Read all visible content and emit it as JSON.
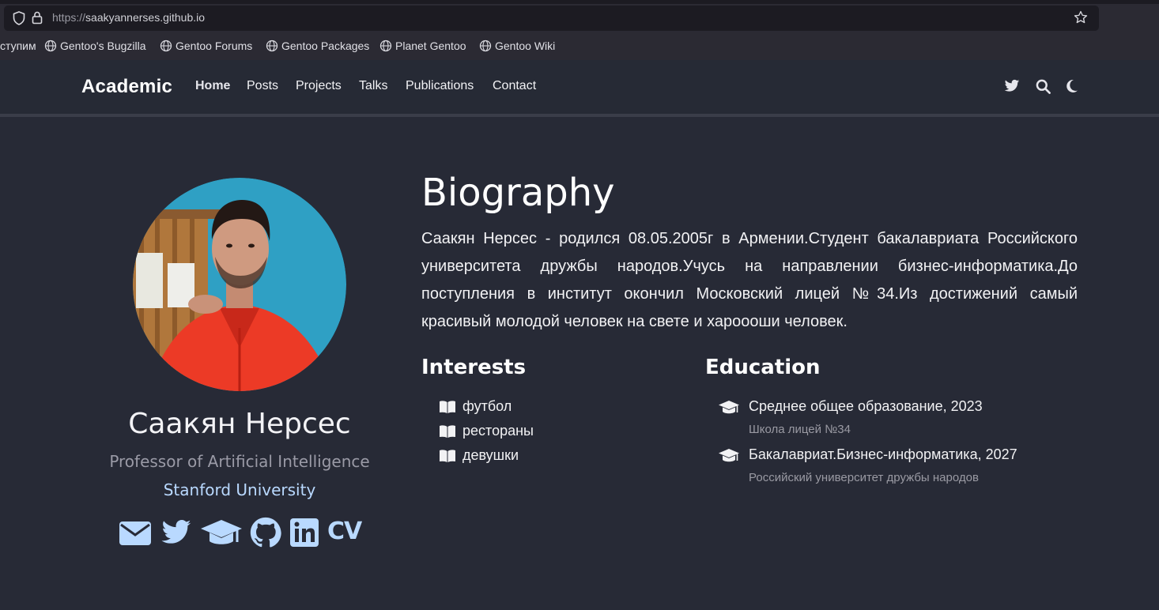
{
  "browser": {
    "url_scheme": "https://",
    "url_host": "saakyannerses.github.io",
    "bookmarks": [
      {
        "label": "ступим"
      },
      {
        "label": "Gentoo's Bugzilla"
      },
      {
        "label": "Gentoo Forums"
      },
      {
        "label": "Gentoo Packages"
      },
      {
        "label": "Planet Gentoo"
      },
      {
        "label": "Gentoo Wiki"
      }
    ]
  },
  "nav": {
    "brand": "Academic",
    "links": [
      "Home",
      "Posts",
      "Projects",
      "Talks",
      "Publications",
      "Contact"
    ],
    "active": "Home"
  },
  "profile": {
    "name": "Саакян Нерсес",
    "role": "Professor of Artificial Intelligence",
    "organization": "Stanford University",
    "cv_label": "CV"
  },
  "biography": {
    "title": "Biography",
    "text": "Саакян Нерсес - родился 08.05.2005г в Армении.Студент бакалавриата Российского университета дружбы народов.Учусь на направлении бизнес-информатика.До поступления в институт окончил Московский лицей №34.Из достижений самый красивый молодой человек на свете и харооoши человек."
  },
  "interests": {
    "title": "Interests",
    "items": [
      "футбол",
      "рестораны",
      "девушки"
    ]
  },
  "education": {
    "title": "Education",
    "items": [
      {
        "course": "Среднее общее образование, 2023",
        "institution": "Школа лицей №34"
      },
      {
        "course": "Бакалавриат.Бизнес-информатика, 2027",
        "institution": "Российский университет дружбы народов"
      }
    ]
  },
  "colors": {
    "background": "#272a36",
    "accent": "#b9d9ff",
    "muted": "#9a9aa6"
  }
}
